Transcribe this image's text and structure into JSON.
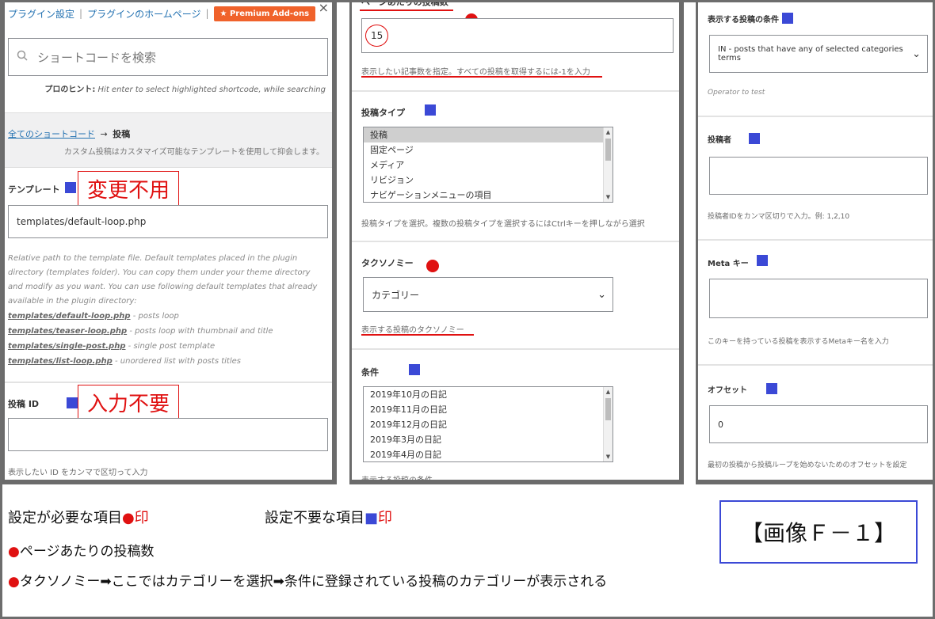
{
  "panel1": {
    "top_links": {
      "settings": "プラグイン設定",
      "separator": "|",
      "homepage": "プラグインのホームページ",
      "separator2": "|",
      "premium": "★ Premium Add-ons",
      "close": "×"
    },
    "search": {
      "placeholder": "ショートコードを検索",
      "hint_label": "プロのヒント:",
      "hint_text": "Hit enter to select highlighted shortcode, while searching"
    },
    "breadcrumb": {
      "root": "全てのショートコード",
      "arrow": "→",
      "current": "投稿",
      "description": "カスタム投稿はカスタマイズ可能なテンプレートを使用して抑会します。"
    },
    "template": {
      "label": "テンプレート",
      "annotation": "変更不用",
      "value": "templates/default-loop.php",
      "help": "Relative path to the template file. Default templates placed in the plugin directory (templates folder). You can copy them under your theme directory and modify as you want. You can use following default templates that already available in the plugin directory:",
      "files": [
        {
          "path": "templates/default-loop.php",
          "desc": " - posts loop"
        },
        {
          "path": "templates/teaser-loop.php",
          "desc": " - posts loop with thumbnail and title"
        },
        {
          "path": "templates/single-post.php",
          "desc": " - single post template"
        },
        {
          "path": "templates/list-loop.php",
          "desc": " - unordered list with posts titles"
        }
      ]
    },
    "post_id": {
      "label": "投稿 ID",
      "annotation": "入力不要",
      "value": "",
      "help": "表示したい ID をカンマで区切って入力"
    }
  },
  "panel2": {
    "per_page": {
      "label": "ページあたりの投稿数",
      "value": "15",
      "help": "表示したい記事数を指定。すべての投稿を取得するには-1を入力"
    },
    "post_type": {
      "label": "投稿タイプ",
      "options": [
        "投稿",
        "固定ページ",
        "メディア",
        "リビジョン",
        "ナビゲーションメニューの項目"
      ],
      "selected": 0,
      "help": "投稿タイプを選択。複数の投稿タイプを選択するにはCtrlキーを押しながら選択"
    },
    "taxonomy": {
      "label": "タクソノミー",
      "value": "カテゴリー",
      "help": "表示する投稿のタクソノミー"
    },
    "terms": {
      "label": "条件",
      "options": [
        "2019年10月の日記",
        "2019年11月の日記",
        "2019年12月の日記",
        "2019年3月の日記",
        "2019年4月の日記"
      ],
      "help": "表示する投稿の条件"
    }
  },
  "panel3": {
    "operator": {
      "label": "表示する投稿の条件",
      "value": "IN - posts that have any of selected categories terms",
      "help": "Operator to test"
    },
    "author": {
      "label": "投稿者",
      "value": "",
      "help": "投稿者IDをカンマ区切りで入力。例: 1,2,10"
    },
    "meta_key": {
      "label": "Meta キー",
      "value": "",
      "help": "このキーを持っている投稿を表示するMetaキー名を入力"
    },
    "offset": {
      "label": "オフセット",
      "value": "0",
      "help": "最初の投稿から投稿ループを始めないためのオフセットを設定"
    }
  },
  "notes": {
    "required_prefix": "設定が必要な項目",
    "required_mark": "●印",
    "optional_prefix": "設定不要な項目",
    "optional_square": "■",
    "optional_mark_suffix": "印",
    "line1_bullet": "●",
    "line1": "ページあたりの投稿数",
    "line2_bullet": "●",
    "line2": "タクソノミー➡ここではカテゴリーを選択➡条件に登録されている投稿のカテゴリーが表示される",
    "caption": "【画像Ｆ－１】"
  },
  "colors": {
    "required_red": "#e01111",
    "optional_blue": "#3b49d6",
    "premium_orange": "#f0622b",
    "link_blue": "#2271b1"
  }
}
